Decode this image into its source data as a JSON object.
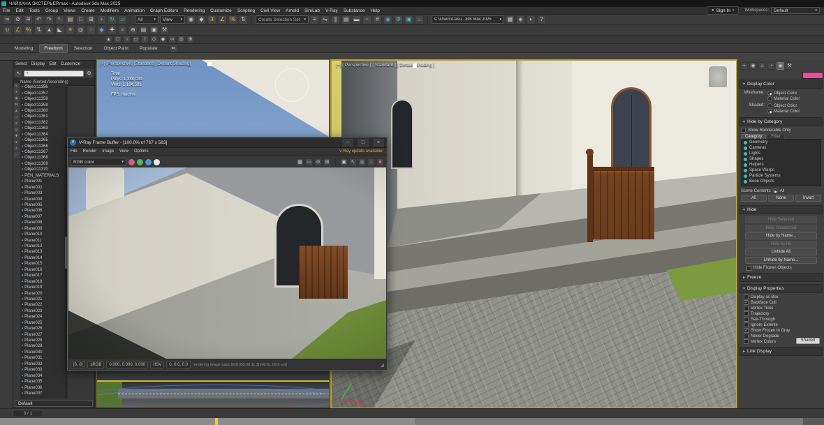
{
  "colors": {
    "accent_yellow": "#d8c23a",
    "viewport_border": "#b9a23a",
    "sky": "#7e9fcd",
    "building_white": "#dfdcd2",
    "pavement_gray": "#90928a",
    "grass_green": "#7e9a40",
    "wood_brown": "#7a4525",
    "vray_notice_orange": "#e0a33c",
    "object_color_pink": "#e0559a",
    "icon_teal": "#45c0b5"
  },
  "titlebar": {
    "title": "ЧАЙХАНА ЭКСТЕРЬЕР.max - Autodesk 3ds Max 2025",
    "sign_in": "Sign In",
    "workspaces_label": "Workspaces:",
    "workspaces_value": "Default"
  },
  "menubar": {
    "items": [
      "File",
      "Edit",
      "Tools",
      "Group",
      "Views",
      "Create",
      "Modifiers",
      "Animation",
      "Graph Editors",
      "Rendering",
      "Customize",
      "Scripting",
      "Civil View",
      "Arnold",
      "SimLab",
      "V-Ray",
      "Substance",
      "Help"
    ]
  },
  "toolbar1": {
    "group1": [
      {
        "name": "select-and-link-icon",
        "glyph": "∞"
      },
      {
        "name": "unlink-selection-icon",
        "glyph": "⊘"
      },
      {
        "name": "bind-to-space-warp-icon",
        "glyph": "≋"
      },
      {
        "name": "undo-icon",
        "glyph": "↶"
      },
      {
        "name": "redo-icon",
        "glyph": "↷"
      },
      {
        "name": "select-object-icon",
        "glyph": "↖",
        "tint": "tint-teal"
      },
      {
        "name": "select-by-name-icon",
        "glyph": "▤"
      },
      {
        "name": "rectangular-selection-icon",
        "glyph": "□"
      },
      {
        "name": "window-crossing-icon",
        "glyph": "⊞"
      },
      {
        "name": "select-and-move-icon",
        "glyph": "+",
        "tint": "tint-teal"
      },
      {
        "name": "select-and-rotate-icon",
        "glyph": "↻",
        "tint": "tint-teal"
      },
      {
        "name": "select-and-scale-icon",
        "glyph": "▱",
        "tint": "tint-teal"
      }
    ],
    "selection_filter_value": "All",
    "ref_coord_value": "View",
    "group2": [
      {
        "name": "use-pivot-center-icon",
        "glyph": "◉"
      },
      {
        "name": "select-and-manipulate-icon",
        "glyph": "◆"
      },
      {
        "name": "snaps-toggle-icon",
        "glyph": "③",
        "tint": "tint-yellow"
      },
      {
        "name": "angle-snap-icon",
        "glyph": "∠",
        "tint": "tint-yellow"
      },
      {
        "name": "percent-snap-icon",
        "glyph": "%",
        "tint": "tint-yellow"
      },
      {
        "name": "spinner-snap-icon",
        "glyph": "⇅"
      }
    ],
    "create_selection_set_placeholder": "Create Selection Set",
    "group3": [
      {
        "name": "edit-named-sets-icon",
        "glyph": "≡"
      },
      {
        "name": "mirror-icon",
        "glyph": "⇋"
      },
      {
        "name": "align-icon",
        "glyph": "∥"
      },
      {
        "name": "layer-explorer-icon",
        "glyph": "▤"
      },
      {
        "name": "toggle-ribbon-icon",
        "glyph": "▬"
      },
      {
        "name": "curve-editor-icon",
        "glyph": "~"
      },
      {
        "name": "schematic-view-icon",
        "glyph": "#"
      },
      {
        "name": "material-editor-icon",
        "glyph": "◉",
        "tint": "tint-blue"
      },
      {
        "name": "render-setup-icon",
        "glyph": "⚙",
        "tint": "tint-teal"
      },
      {
        "name": "rendered-frame-window-icon",
        "glyph": "▣",
        "tint": "tint-teal"
      },
      {
        "name": "render-production-icon",
        "glyph": "♨",
        "tint": "tint-teal"
      }
    ],
    "project_path": "C:\\Users\\Casu...3ds Max 2025",
    "group4": [
      {
        "name": "asset-tracking-icon",
        "glyph": "▦"
      },
      {
        "name": "civil-view-icon",
        "glyph": "◈"
      },
      {
        "name": "arnold-icon",
        "glyph": "◐"
      },
      {
        "name": "help-icon",
        "glyph": "?"
      }
    ]
  },
  "toolbar2": {
    "icons": [
      {
        "name": "snaps-magnet-icon",
        "glyph": "∪",
        "tint": "tint-yellow"
      },
      {
        "name": "angle-snap-2-icon",
        "glyph": "∠",
        "tint": "tint-yellow"
      },
      {
        "name": "percent-snap-2-icon",
        "glyph": "%",
        "tint": "tint-yellow"
      },
      {
        "name": "spinner-snap-2-icon",
        "glyph": "⇅"
      },
      {
        "name": "polygon-tool-icon",
        "glyph": "▲"
      },
      {
        "name": "modeling-tool-icon",
        "glyph": "◣"
      },
      {
        "name": "light-tool-icon",
        "glyph": "☀",
        "tint": "tint-yellow"
      },
      {
        "name": "camera-tool-icon",
        "glyph": "◎"
      },
      {
        "name": "shapes-tool-icon",
        "glyph": "○",
        "tint": "tint-green"
      },
      {
        "name": "geometry-tool-icon",
        "glyph": "◆",
        "tint": "tint-blue"
      },
      {
        "name": "helpers-tool-icon",
        "glyph": "✚"
      },
      {
        "name": "space-warp-tool-icon",
        "glyph": "≈"
      },
      {
        "name": "systems-tool-icon",
        "glyph": "⊕"
      },
      {
        "name": "layers-tool-icon",
        "glyph": "▤"
      },
      {
        "name": "display-tool-icon",
        "glyph": "▣"
      },
      {
        "name": "utilities-tool-icon",
        "glyph": "⚒"
      }
    ]
  },
  "ribbon": {
    "mini_icons": [
      {
        "name": "polygon-modeling-icon",
        "glyph": "▲"
      },
      {
        "name": "box-primitive-icon",
        "glyph": "□"
      },
      {
        "name": "sphere-primitive-icon",
        "glyph": "○"
      },
      {
        "name": "cylinder-primitive-icon",
        "glyph": "▭"
      },
      {
        "name": "edge-mode-icon",
        "glyph": "/"
      },
      {
        "name": "border-mode-icon",
        "glyph": "◇"
      },
      {
        "name": "element-mode-icon",
        "glyph": "◆"
      },
      {
        "name": "loop-select-icon",
        "glyph": "∞"
      },
      {
        "name": "ring-select-icon",
        "glyph": "◎"
      },
      {
        "name": "grow-select-icon",
        "glyph": "⊕"
      }
    ],
    "tabs": [
      {
        "label": "Modeling"
      },
      {
        "label": "Freeform",
        "state": "active"
      },
      {
        "label": "Selection"
      },
      {
        "label": "Object Paint"
      },
      {
        "label": "Populate"
      }
    ]
  },
  "explorer": {
    "menu": [
      "Select",
      "Display",
      "Edit",
      "Customize"
    ],
    "header": "Name (Sorted Ascending)",
    "footer": "Default",
    "strip_icons": [
      {
        "name": "find-object-icon",
        "glyph": "◎"
      },
      {
        "name": "select-children-icon",
        "glyph": "▾"
      },
      {
        "name": "lock-selection-icon",
        "glyph": "◉"
      },
      {
        "name": "sync-selection-icon",
        "glyph": "⇆"
      },
      {
        "name": "filter-geometry-icon",
        "glyph": "▲"
      },
      {
        "name": "filter-shapes-icon",
        "glyph": "○"
      },
      {
        "name": "filter-lights-icon",
        "glyph": "☀"
      },
      {
        "name": "filter-cameras-icon",
        "glyph": "◎"
      },
      {
        "name": "filter-helpers-icon",
        "glyph": "✚"
      },
      {
        "name": "filter-materials-icon",
        "glyph": "●"
      },
      {
        "name": "expand-all-icon",
        "glyph": "+"
      },
      {
        "name": "collapse-all-icon",
        "glyph": "−"
      }
    ],
    "items": [
      {
        "label": "Object11356"
      },
      {
        "label": "Object11357"
      },
      {
        "label": "Object11358"
      },
      {
        "label": "Object11359"
      },
      {
        "label": "Object11360"
      },
      {
        "label": "Object11361"
      },
      {
        "label": "Object11362"
      },
      {
        "label": "Object11363"
      },
      {
        "label": "Object11364"
      },
      {
        "label": "Object11365"
      },
      {
        "label": "Object11366"
      },
      {
        "label": "Object11367"
      },
      {
        "label": "Object11368"
      },
      {
        "label": "Object11369"
      },
      {
        "label": "Object11370"
      },
      {
        "label": "PEN_MATERIALS",
        "tint": "tint-red"
      },
      {
        "label": "Plane001"
      },
      {
        "label": "Plane002"
      },
      {
        "label": "Plane003"
      },
      {
        "label": "Plane004"
      },
      {
        "label": "Plane005"
      },
      {
        "label": "Plane006"
      },
      {
        "label": "Plane007"
      },
      {
        "label": "Plane008"
      },
      {
        "label": "Plane009"
      },
      {
        "label": "Plane010"
      },
      {
        "label": "Plane011"
      },
      {
        "label": "Plane012"
      },
      {
        "label": "Plane013"
      },
      {
        "label": "Plane014"
      },
      {
        "label": "Plane015"
      },
      {
        "label": "Plane016"
      },
      {
        "label": "Plane017"
      },
      {
        "label": "Plane018"
      },
      {
        "label": "Plane019"
      },
      {
        "label": "Plane020"
      },
      {
        "label": "Plane021"
      },
      {
        "label": "Plane022"
      },
      {
        "label": "Plane023"
      },
      {
        "label": "Plane024"
      },
      {
        "label": "Plane025"
      },
      {
        "label": "Plane026"
      },
      {
        "label": "Plane027"
      },
      {
        "label": "Plane028"
      },
      {
        "label": "Plane029"
      },
      {
        "label": "Plane030"
      },
      {
        "label": "Plane031"
      },
      {
        "label": "Plane032"
      },
      {
        "label": "Plane033"
      },
      {
        "label": "Plane034"
      },
      {
        "label": "Plane035"
      },
      {
        "label": "Plane036"
      },
      {
        "label": "Plane037"
      }
    ]
  },
  "viewports": {
    "left_label": "[+] [Perspective] [Standard] [Default Shading]",
    "right_label": "[+] [ Perspective ] [ Standard ] [ Default Shading ]",
    "stats": {
      "total": "Total",
      "polys": "Polys: 1,388,039",
      "verts": "Verts: 1,194,581",
      "fps": "FPS: Inactive"
    }
  },
  "vfb": {
    "title": "V-Ray Frame Buffer - [100.0% of 767 x 583]",
    "menus": [
      "File",
      "Render",
      "Image",
      "View",
      "Options"
    ],
    "channel_value": "RGB color",
    "update_notice": "V-Ray update available!",
    "icons_a": [
      {
        "name": "save-image-icon",
        "glyph": "▦"
      },
      {
        "name": "load-image-icon",
        "glyph": "▭"
      },
      {
        "name": "clear-image-icon",
        "glyph": "⊘"
      },
      {
        "name": "duplicate-to-host-icon",
        "glyph": "⊞"
      }
    ],
    "icons_b": [
      {
        "name": "region-render-icon",
        "glyph": "▣"
      },
      {
        "name": "follow-mouse-icon",
        "glyph": "↖"
      },
      {
        "name": "track-mouse-icon",
        "glyph": "◎"
      },
      {
        "name": "render-last-icon",
        "glyph": "♨",
        "tint": "tint-teal"
      },
      {
        "name": "stop-render-icon",
        "glyph": "■",
        "tint": "tint-red"
      }
    ],
    "status": {
      "coords": "[0, 0]",
      "srgb": "sRGB",
      "rgb": "0.000, 0.000, 0.000",
      "hsv_label": "HSV",
      "hsv": "0, 0.0, 0.0",
      "message": "rendering image pass [0/1] [00:00:11.3] [00:01:09.5 est]"
    }
  },
  "command_panel": {
    "tabs": [
      {
        "name": "create-tab-icon",
        "glyph": "+"
      },
      {
        "name": "modify-tab-icon",
        "glyph": "◉"
      },
      {
        "name": "hierarchy-tab-icon",
        "glyph": "⌂"
      },
      {
        "name": "motion-tab-icon",
        "glyph": "◔"
      },
      {
        "name": "display-tab-icon",
        "glyph": "▣",
        "state": "active"
      },
      {
        "name": "utilities-tab-icon",
        "glyph": "⚒"
      }
    ],
    "display_color": {
      "title": "Display Color",
      "wireframe_label": "Wireframe:",
      "shaded_label": "Shaded:",
      "options": [
        "Object Color",
        "Material Color"
      ],
      "wireframe_selected": "Object Color",
      "shaded_selected": "Material Color"
    },
    "hide_by_category": {
      "title": "Hide by Category",
      "show_renderable_only": "Show Renderable Only",
      "tabs": [
        "Category",
        "Filter"
      ],
      "items": [
        "Geometry",
        "Cameras",
        "Lights",
        "Shapes",
        "Helpers",
        "Space Warps",
        "Particle Systems",
        "Bone Objects"
      ],
      "scene_contents_label": "Scene Contents",
      "scene_contents_value": "All",
      "buttons": [
        "All",
        "None",
        "Invert"
      ]
    },
    "hide": {
      "title": "Hide",
      "buttons": [
        {
          "label": "Hide Selected",
          "state": "disabled"
        },
        {
          "label": "Hide Unselected",
          "state": "disabled"
        },
        {
          "label": "Hide by Name...",
          "state": ""
        },
        {
          "label": "Hide by Hit",
          "state": "disabled"
        },
        {
          "label": "Unhide All",
          "state": ""
        },
        {
          "label": "Unhide by Name...",
          "state": ""
        }
      ],
      "hide_frozen_label": "Hide Frozen Objects"
    },
    "freeze": {
      "title": "Freeze"
    },
    "display_properties": {
      "title": "Display Properties",
      "checkboxes": [
        {
          "label": "Display as Box",
          "state": ""
        },
        {
          "label": "Backface Cull",
          "state": "checked"
        },
        {
          "label": "Vertex Ticks",
          "state": ""
        },
        {
          "label": "Trajectory",
          "state": ""
        },
        {
          "label": "See-Through",
          "state": ""
        },
        {
          "label": "Ignore Extents",
          "state": ""
        },
        {
          "label": "Show Frozen in Gray",
          "state": "checked"
        },
        {
          "label": "Never Degrade",
          "state": ""
        },
        {
          "label": "Vertex Colors",
          "state": ""
        }
      ],
      "shaded_button": "Shaded"
    },
    "link_display": {
      "title": "Link Display"
    }
  },
  "statusbar": {
    "frame_indicator": "0 / 1"
  }
}
